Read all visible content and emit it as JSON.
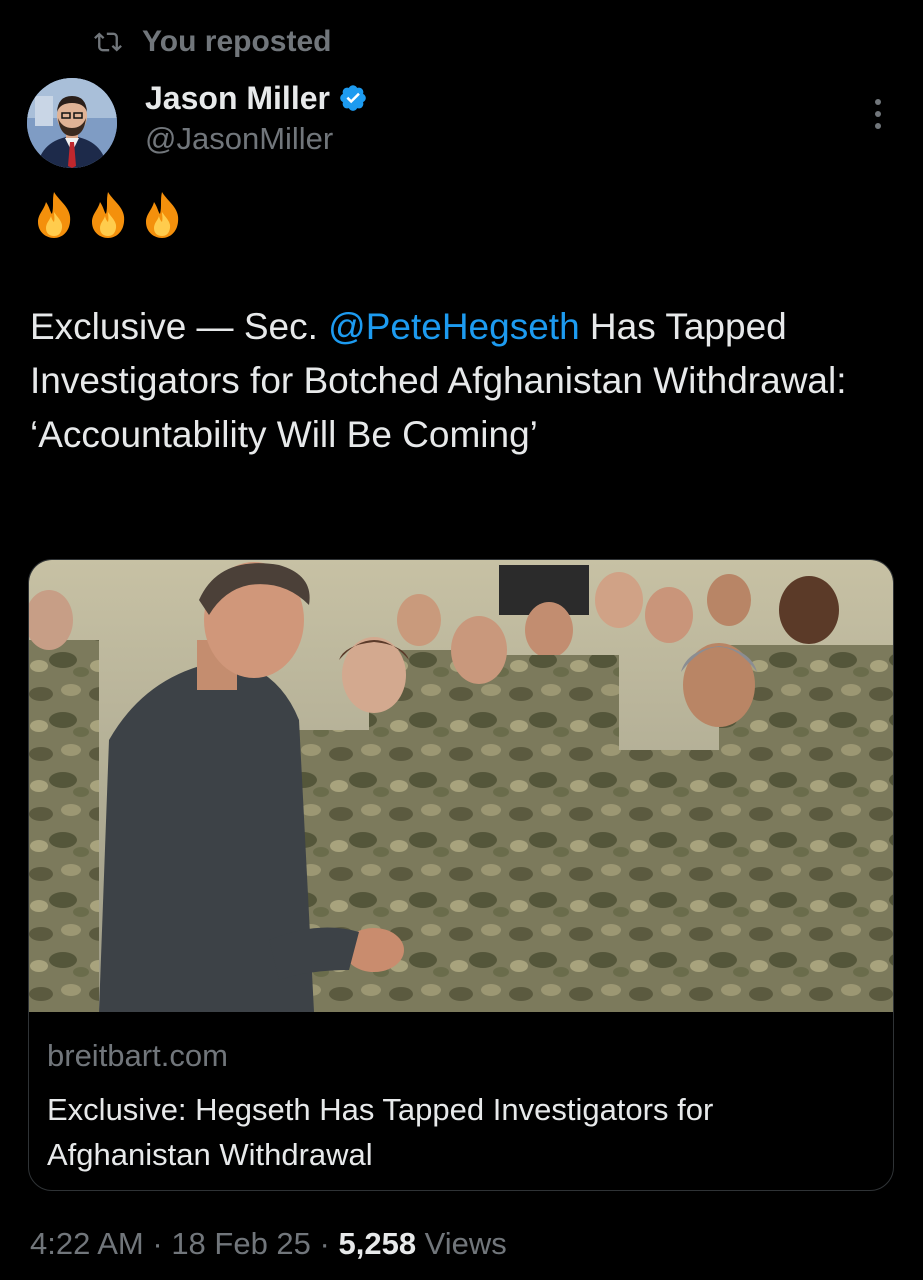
{
  "repost": {
    "label": "You reposted"
  },
  "author": {
    "name": "Jason Miller",
    "handle": "@JasonMiller",
    "verified": true
  },
  "tweet": {
    "emojis": [
      "🔥",
      "🔥",
      "🔥"
    ],
    "text_before": "Exclusive — Sec. ",
    "mention": "@PeteHegseth",
    "text_after": " Has Tapped Investigators for Botched Afghanistan Withdrawal: ‘Accountability Will Be Coming’"
  },
  "link_card": {
    "image_description_icon": "news-photo",
    "domain": "breitbart.com",
    "title": "Exclusive: Hegseth Has Tapped Investigators for Afghanistan Withdrawal"
  },
  "meta": {
    "time": "4:22 AM",
    "sep1": " · ",
    "date": "18 Feb 25",
    "sep2": " · ",
    "views_count": "5,258",
    "views_label": " Views"
  },
  "colors": {
    "background": "#000000",
    "text": "#e7e9ea",
    "muted": "#71767b",
    "accent": "#1d9bf0",
    "border": "#2f3336"
  }
}
